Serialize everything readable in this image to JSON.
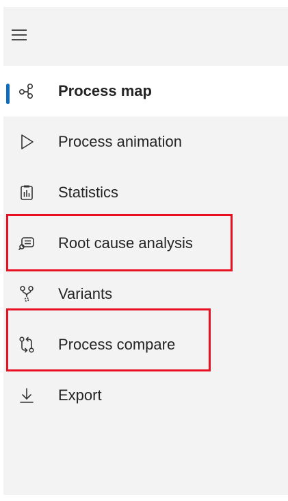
{
  "toolbar": {
    "menu_icon": "hamburger-icon"
  },
  "nav": {
    "items": [
      {
        "label": "Process map",
        "icon": "process-map-icon",
        "selected": true
      },
      {
        "label": "Process animation",
        "icon": "play-icon",
        "selected": false
      },
      {
        "label": "Statistics",
        "icon": "statistics-icon",
        "selected": false
      },
      {
        "label": "Root cause analysis",
        "icon": "root-cause-icon",
        "selected": false
      },
      {
        "label": "Variants",
        "icon": "variants-icon",
        "selected": false
      },
      {
        "label": "Process compare",
        "icon": "compare-icon",
        "selected": false
      },
      {
        "label": "Export",
        "icon": "export-icon",
        "selected": false
      }
    ]
  },
  "colors": {
    "selected_indicator": "#0f6cbd",
    "highlight_border": "#e81123",
    "panel_bg": "#f3f3f3"
  }
}
